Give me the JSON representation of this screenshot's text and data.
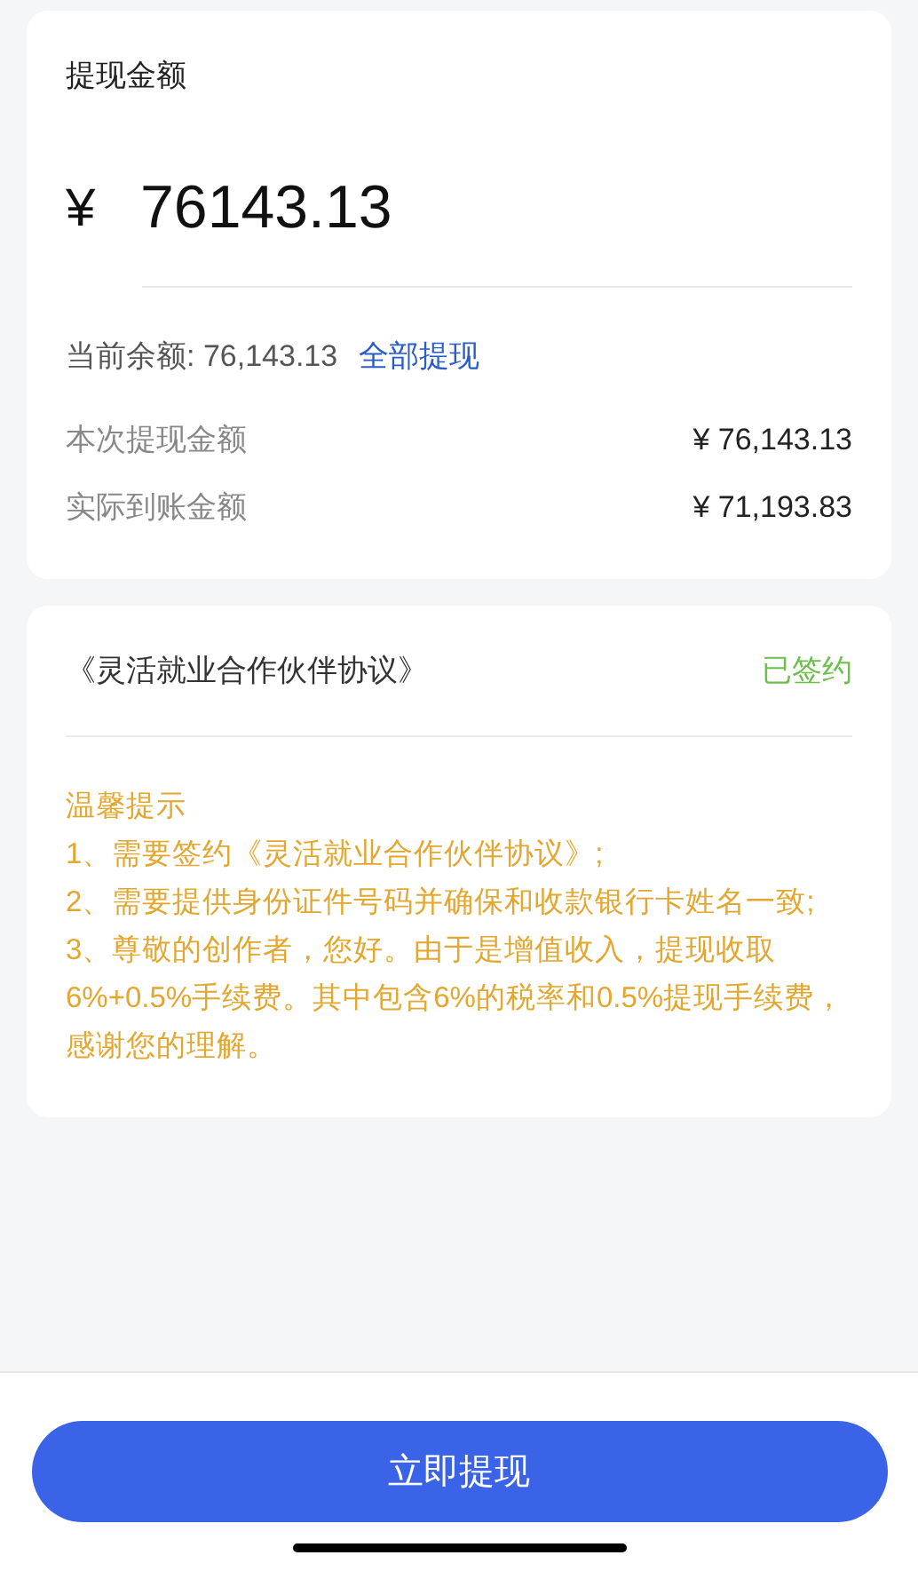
{
  "amount_card": {
    "title": "提现金额",
    "currency": "¥",
    "amount": "76143.13",
    "balance_label": "当前余额: 76,143.13",
    "withdraw_all": "全部提现",
    "rows": [
      {
        "label": "本次提现金额",
        "value": "¥ 76,143.13"
      },
      {
        "label": "实际到账金额",
        "value": "¥ 71,193.83"
      }
    ]
  },
  "agreement_card": {
    "agreement": "《灵活就业合作伙伴协议》",
    "status": {
      "text": "已签约",
      "signed": true
    },
    "tips_title": "温馨提示",
    "tips": [
      "1、需要签约《灵活就业合作伙伴协议》;",
      "2、需要提供身份证件号码并确保和收款银行卡姓名一致;",
      "3、尊敬的创作者，您好。由于是增值收入，提现收取6%+0.5%手续费。其中包含6%的税率和0.5%提现手续费，感谢您的理解。"
    ]
  },
  "submit_button": "立即提现"
}
